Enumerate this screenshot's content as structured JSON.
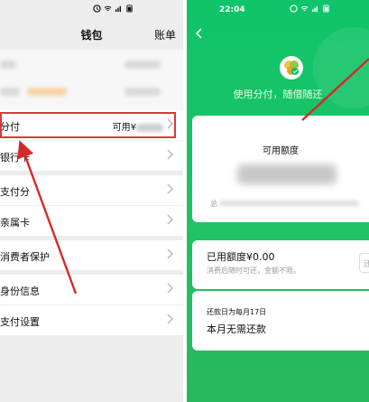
{
  "left": {
    "status_time": "",
    "nav": {
      "title": "钱包",
      "right": "账单"
    },
    "rows": {
      "fenfu": {
        "label": "分付",
        "value_prefix": "可用¥"
      },
      "bankcard": {
        "label": "银行卡"
      },
      "zhifufen": {
        "label": "支付分"
      },
      "qinshuka": {
        "label": "亲属卡"
      },
      "consumer": {
        "label": "消费者保护"
      },
      "identity": {
        "label": "身份信息"
      },
      "paysettings": {
        "label": "支付设置"
      }
    }
  },
  "right": {
    "status_time": "22:04",
    "slogan": "使用分付，随借随还",
    "credit_title": "可用额度",
    "total_prefix": "总",
    "used": "已用额度¥0.00",
    "used_sub": "消费后随时可还，金额不限。",
    "repay_btn": "还",
    "repay_day": "还款日为每月17日",
    "repay_status": "本月无需还款"
  },
  "colors": {
    "green": "#07c160",
    "highlight_red": "#d43b3b",
    "arrow_red": "#d42a2a"
  },
  "icons": [
    "chevron-right-icon",
    "back-arrow-icon",
    "wechat-pay-logo-icon",
    "alarm-icon",
    "wifi-icon",
    "signal-icon",
    "battery-icon"
  ]
}
